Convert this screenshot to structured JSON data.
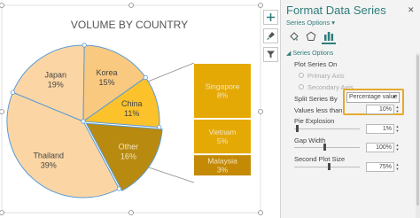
{
  "chart_data": {
    "type": "pie",
    "title": "VOLUME BY COUNTRY",
    "pie": [
      {
        "label": "Thailand",
        "value": 39,
        "value_label": "39%",
        "color": "#fbd6a4"
      },
      {
        "label": "Japan",
        "value": 19,
        "value_label": "19%",
        "color": "#fbd6a4"
      },
      {
        "label": "Korea",
        "value": 15,
        "value_label": "15%",
        "color": "#f9c980"
      },
      {
        "label": "China",
        "value": 11,
        "value_label": "11%",
        "color": "#fbc22b"
      },
      {
        "label": "Other",
        "value": 16,
        "value_label": "16%",
        "color": "#b88a10",
        "selected": true
      }
    ],
    "secondary_bar": [
      {
        "label": "Singapore",
        "value": 8,
        "value_label": "8%",
        "color": "#e5a905"
      },
      {
        "label": "Vietnam",
        "value": 5,
        "value_label": "5%",
        "color": "#e5a905"
      },
      {
        "label": "Malaysia",
        "value": 3,
        "value_label": "3%",
        "color": "#c58a05"
      }
    ]
  },
  "chart_tools": {
    "add_element_icon": "plus-icon",
    "style_icon": "paintbrush-icon",
    "filter_icon": "funnel-icon"
  },
  "pane": {
    "title": "Format Data Series",
    "close_glyph": "✕",
    "menu_label": "Series Options ▾",
    "tabs": [
      "fill-line-icon",
      "effects-pentagon-icon",
      "series-options-chart-icon"
    ],
    "section_header": "◢ Series Options",
    "plot_series_on": "Plot Series On",
    "primary_axis": "Primary Axis",
    "secondary_axis": "Secondary Axis",
    "split_series_by_label": "Split Series By",
    "split_series_by_value": "Percentage value",
    "values_less_than_label": "Values less than",
    "values_less_than_value": "10%",
    "pie_explosion_label": "Pie Explosion",
    "pie_explosion_value": "1%",
    "gap_width_label": "Gap Width",
    "gap_width_value": "100%",
    "second_plot_size_label": "Second Plot Size",
    "second_plot_size_value": "75%",
    "accent_color": "#2f7d7a",
    "highlight_color": "#e4ab2f"
  }
}
